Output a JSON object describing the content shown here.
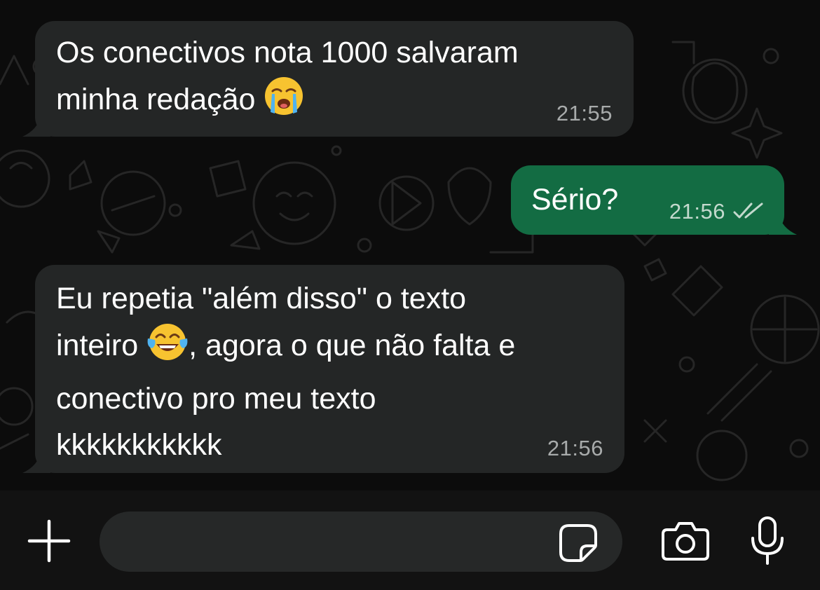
{
  "theme": {
    "chat_background": "#0c0c0c",
    "incoming_bubble": "#242626",
    "outgoing_bubble": "#136c43",
    "input_bar_background": "#121212",
    "input_field_background": "#262828",
    "icon_color": "#ffffff"
  },
  "messages": [
    {
      "direction": "incoming",
      "text": "Os conectivos nota 1000 salvaram\nminha redação",
      "emoji": "loudly-crying-face",
      "time": "21:55"
    },
    {
      "direction": "outgoing",
      "text": "Sério?",
      "time": "21:56",
      "status": "read-double-check"
    },
    {
      "direction": "incoming",
      "text_before_emoji": "Eu repetia \"além disso\" o texto\ninteiro ",
      "emoji": "face-with-tears-of-joy",
      "text_after_emoji": ", agora o que não falta e\nconectivo pro meu texto\nkkkkkkkkkkk",
      "time": "21:56"
    }
  ],
  "composer": {
    "input_value": "",
    "icons": [
      "plus-icon",
      "sticker-icon",
      "camera-icon",
      "microphone-icon"
    ]
  }
}
